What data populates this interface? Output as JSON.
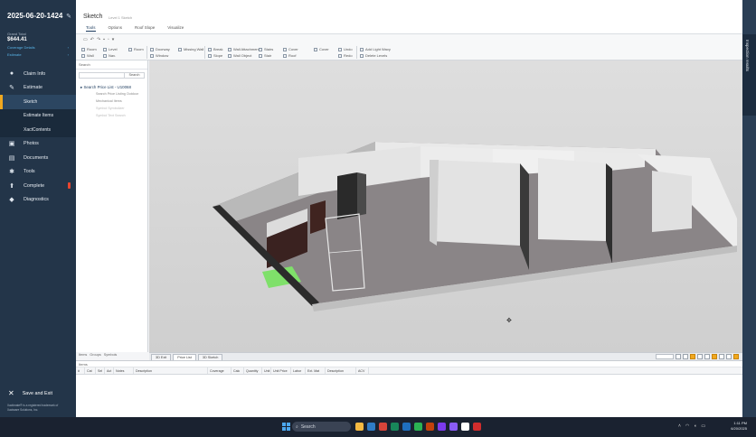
{
  "sidebar": {
    "claim_id": "2025-06-20-1424",
    "grand_total_label": "Grand Total",
    "grand_total_value": "$644.41",
    "link_coverage": "Coverage Details",
    "link_estimate": "Estimate",
    "items": [
      {
        "label": "Claim Info",
        "icon": "info-icon"
      },
      {
        "label": "Estimate",
        "icon": "edit-icon"
      },
      {
        "label": "Sketch",
        "sub": true,
        "active": true
      },
      {
        "label": "Estimate Items",
        "sub": true
      },
      {
        "label": "XactContents",
        "sub": true
      },
      {
        "label": "Photos",
        "icon": "photos-icon"
      },
      {
        "label": "Documents",
        "icon": "documents-icon"
      },
      {
        "label": "Tools",
        "icon": "wrench-icon"
      },
      {
        "label": "Complete",
        "icon": "upload-icon"
      },
      {
        "label": "Diagnostics",
        "icon": "diagnostics-icon"
      }
    ],
    "save_exit": "Save and Exit",
    "trademark": "Xactimate® is a registered trademark of Xactware Solutions, Inc."
  },
  "window": {
    "title": "Sketch",
    "breadcrumb": "Level 1 Sketch",
    "tabs": [
      "Tools",
      "Options",
      "Roof Slope",
      "Visualize"
    ],
    "ribbon": [
      [
        "Room",
        "Wall"
      ],
      [
        "Level",
        "Nav.",
        "Room"
      ],
      [
        "Doorway",
        "Window"
      ],
      [
        "Missing Wall"
      ],
      [
        "Break",
        "Slope"
      ],
      [
        "Wall Attachment",
        "Wall Object"
      ],
      [
        "Stairs",
        "Stair"
      ],
      [
        "Cover",
        "Roof",
        "Cover"
      ],
      [
        "Undo",
        "Redo"
      ],
      [
        "Add Light Wavy",
        "Delete Levels"
      ]
    ]
  },
  "tree": {
    "title": "Search",
    "search_button": "Search",
    "root": "Search Price List - U10068",
    "children": [
      "Search Price Listing Outdoor",
      "Mechanical Items",
      "Symbol Symbolizer",
      "Symbol Text Search"
    ]
  },
  "tree_tabs": [
    "Items",
    "Groups",
    "Symbols"
  ],
  "view_tabs": [
    "3D Exit",
    "Price List",
    "3D Sketch"
  ],
  "grid": {
    "title": "Items",
    "columns": [
      "#",
      "Cat",
      "Sel",
      "Act",
      "Notes",
      "Description",
      "Coverage",
      "Calc",
      "Quantity",
      "Unit",
      "Unit Price",
      "Labor",
      "Ext. Mat",
      "Description",
      "ACV"
    ]
  },
  "rail": {
    "label": "Inspection results"
  },
  "taskbar": {
    "search": "Search",
    "time": "1:11 PM",
    "date": "6/20/2025",
    "icon_colors": [
      "#f4b942",
      "#2f7cc7",
      "#d8443a",
      "#2bb353",
      "#1f6fbf",
      "#18865a",
      "#c2410c",
      "#7c3aed",
      "#8a5cf6",
      "#ffffff",
      "#d12d2d"
    ]
  },
  "colors": {
    "sidebar_bg": "#233549",
    "accent": "#f0a81f",
    "link": "#58b4e8"
  }
}
